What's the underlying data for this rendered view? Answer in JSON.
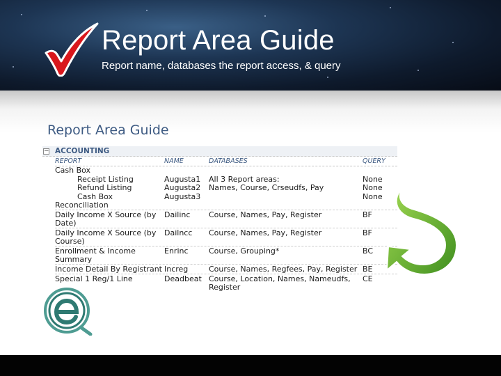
{
  "slide": {
    "title": "Report Area Guide",
    "subtitle": "Report name, databases the report access, & query"
  },
  "report": {
    "heading": "Report Area Guide",
    "group": "ACCOUNTING",
    "expander": "−",
    "columns": [
      "REPORT",
      "NAME",
      "DATABASES",
      "QUERY"
    ],
    "rows": [
      {
        "report": "Cash Box",
        "name": "",
        "databases": "",
        "query": ""
      },
      {
        "report": "Receipt Listing",
        "name": "Augusta1",
        "databases": "All 3 Report areas:",
        "query": "None"
      },
      {
        "report": "Refund Listing",
        "name": "Augusta2",
        "databases": "Names, Course, Crseudfs, Pay",
        "query": "None"
      },
      {
        "report": "Cash Box",
        "name": "Augusta3",
        "databases": "",
        "query": "None"
      },
      {
        "report": "Reconciliation",
        "name": "",
        "databases": "",
        "query": ""
      },
      {
        "report": "Daily Income X Source (by",
        "name": "Dailinc",
        "databases": "Course, Names, Pay, Register",
        "query": "BF"
      },
      {
        "report": "Date)",
        "name": "",
        "databases": "",
        "query": ""
      },
      {
        "report": "Daily Income X Source (by",
        "name": "Dailncc",
        "databases": "Course, Names, Pay, Register",
        "query": "BF"
      },
      {
        "report": "Course)",
        "name": "",
        "databases": "",
        "query": ""
      },
      {
        "report": "Enrollment & Income",
        "name": "Enrinc",
        "databases": "Course, Grouping*",
        "query": "BC"
      },
      {
        "report": "Summary",
        "name": "",
        "databases": "",
        "query": ""
      },
      {
        "report": "Income Detail By Registrant",
        "name": "Increg",
        "databases": "Course, Names, Regfees, Pay, Register",
        "query": "BE"
      },
      {
        "report": "Special 1 Reg/1 Line",
        "name": "Deadbeat",
        "databases": "Course, Location, Names, Nameudfs,",
        "query": "CE"
      },
      {
        "report": "",
        "name": "",
        "databases": "Register",
        "query": ""
      }
    ]
  },
  "icons": {
    "checkmark": "red-checkmark-icon",
    "swirl": "green-return-arrow-icon",
    "logo": "e-logo-icon"
  },
  "colors": {
    "checkmark": "#d9171c",
    "swirl": "#6bb530",
    "logo": "#3e8f86",
    "heading": "#3d5a82"
  }
}
